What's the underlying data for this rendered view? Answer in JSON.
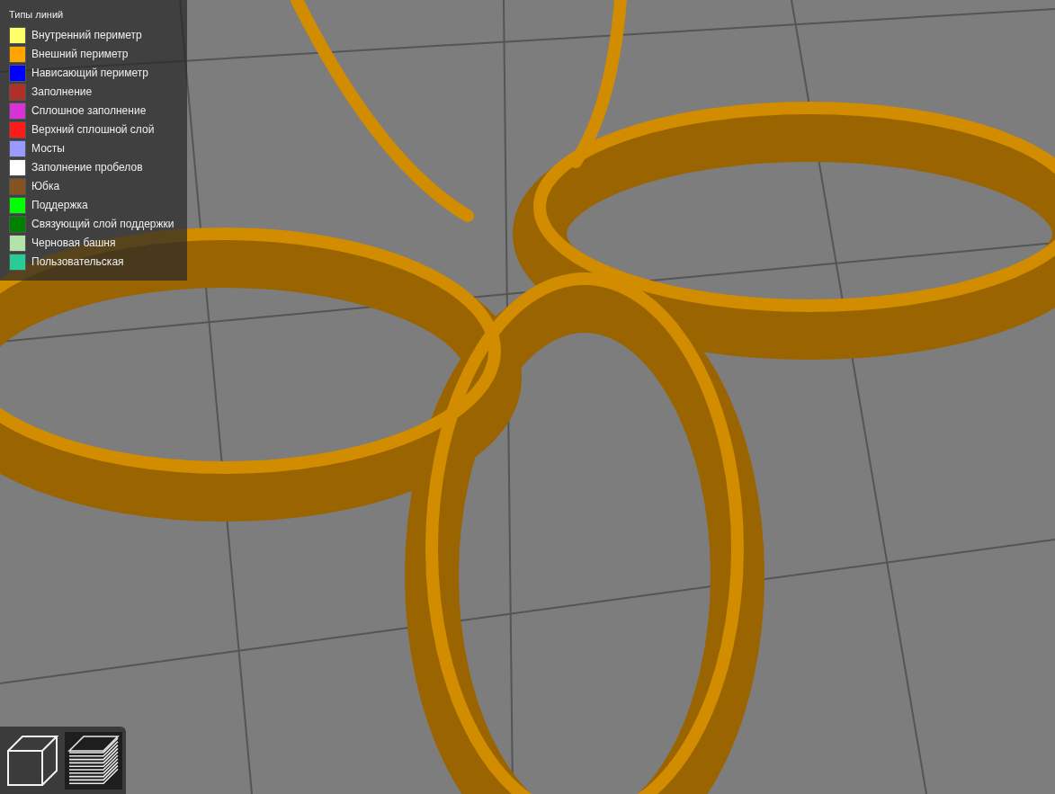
{
  "legend": {
    "title": "Типы линий",
    "items": [
      {
        "label": "Внутренний периметр",
        "color": "#ffff68"
      },
      {
        "label": "Внешний периметр",
        "color": "#ffa500"
      },
      {
        "label": "Нависающий периметр",
        "color": "#0000ff"
      },
      {
        "label": "Заполнение",
        "color": "#b03029"
      },
      {
        "label": "Сплошное заполнение",
        "color": "#d732d7"
      },
      {
        "label": "Верхний сплошной слой",
        "color": "#ff1a1a"
      },
      {
        "label": "Мосты",
        "color": "#9999ff"
      },
      {
        "label": "Заполнение пробелов",
        "color": "#ffffff"
      },
      {
        "label": "Юбка",
        "color": "#845321"
      },
      {
        "label": "Поддержка",
        "color": "#00ff00"
      },
      {
        "label": "Связующий слой поддержки",
        "color": "#008000"
      },
      {
        "label": "Черновая башня",
        "color": "#b3e3ab"
      },
      {
        "label": "Пользовательская",
        "color": "#28cc94"
      }
    ]
  },
  "view_buttons": [
    {
      "kind": "solid",
      "selected": false
    },
    {
      "kind": "preview",
      "selected": true
    }
  ]
}
